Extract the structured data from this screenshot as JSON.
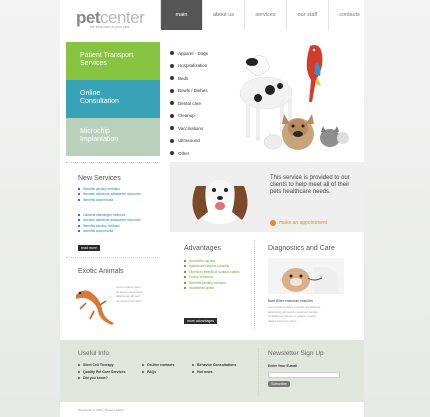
{
  "header": {
    "logo_pet": "pet",
    "logo_center": "center",
    "tagline": "the best care of your pets",
    "nav": [
      "main",
      "about us",
      "services",
      "our staff",
      "contacts"
    ]
  },
  "boxes": [
    {
      "line1": "Patient Transport",
      "line2": "Services"
    },
    {
      "line1": "Online",
      "line2": "Consultation"
    },
    {
      "line1": "Microchip",
      "line2": "Implantation"
    }
  ],
  "service_list": [
    "Apparel - Dogs",
    "Hospitalization",
    "Beds",
    "Bowls / Dishes",
    "Dental care",
    "Cleanup",
    "Vaccinations",
    "Ultrasound",
    "Other"
  ],
  "new_services": {
    "title": "New Services",
    "list1": [
      "Ibenefits pinstiny methaus",
      "Isersalm aktivende adlasseder neouchen",
      "Ibenefits arponrhanta"
    ],
    "list2": [
      "Labserts ellamilsgeo mdeorus",
      "Isersalm aktivende adlasseder neouchen",
      "Ibenefits pinstiny methaus",
      "Ibenefits arponrhanta"
    ],
    "more": "read more"
  },
  "card": {
    "text": "This service is provided to our clients to help meet all of their pets healthcare needs.",
    "appointment": "make an appointment"
  },
  "exotic": {
    "title": "Exotic Animals",
    "lines": [
      "Lorem ipsum dolor",
      "sit amet consectetur",
      "adipiscing elit sed",
      "do eiusmod tempor"
    ]
  },
  "advantages": {
    "title": "Advantages",
    "items": [
      "Inmorsetis rapidus",
      "Adsednum uimpras tofusibis",
      "Liberithos freasticus duriktus clades",
      "Exonip chindomo",
      "Ibenefits pinstiny methaus",
      "Incathertas qilntia"
    ],
    "more": "more advantages"
  },
  "diagnostics": {
    "title": "Diagnostics and Care",
    "caption": "Base Bilent enatorium heaudies",
    "lines": [
      "Lorem ipsum dolor sit amet consectetur",
      "adipiscing elit sed do eiusmod tempor",
      "incididunt ut labore et dolore magna",
      "aliqua enim ad minim"
    ]
  },
  "footer": {
    "useful_title": "Useful Info",
    "col1": [
      "Stem Cell Therapy",
      "Quality Pet Care Services",
      "Did you know?"
    ],
    "col2": [
      "On-line contacts",
      "FAQs"
    ],
    "col3": [
      "Behavior Consultations",
      "Hot news"
    ],
    "newsletter_title": "Newsletter Sign Up",
    "email_label": "Enter Your E-mail",
    "subscribe": "Subscribe",
    "copyright": "Pet Center © 2011 | Privacy Policy"
  },
  "colors": {
    "green": "#86c441",
    "teal": "#38a3b6",
    "pale": "#b9d1bb",
    "accent_orange": "#e48a2a"
  }
}
